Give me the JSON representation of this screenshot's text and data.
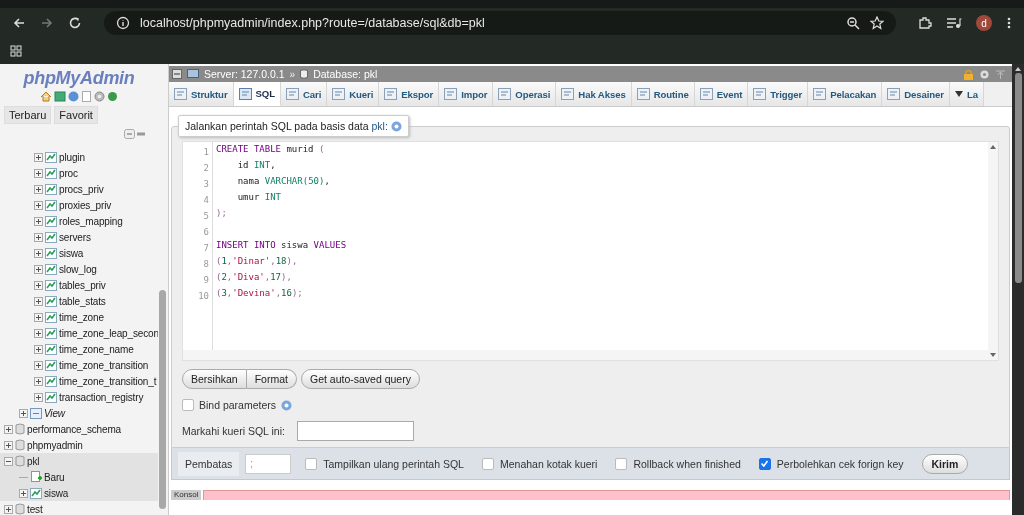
{
  "browser": {
    "url": "localhost/phpmyadmin/index.php?route=/database/sql&db=pkl",
    "profile_initial": "d"
  },
  "sidebar": {
    "logo": "phpMyAdmin",
    "buttons": [
      {
        "label": "Terbaru"
      },
      {
        "label": "Favorit"
      }
    ],
    "tree": [
      {
        "selected": false,
        "children": [
          {
            "children": [
              {
                "label": "plugin",
                "kind": "table",
                "expanded": false
              },
              {
                "label": "proc",
                "kind": "table",
                "expanded": false
              },
              {
                "label": "procs_priv",
                "kind": "table",
                "expanded": false
              },
              {
                "label": "proxies_priv",
                "kind": "table",
                "expanded": false
              },
              {
                "label": "roles_mapping",
                "kind": "table",
                "expanded": false
              },
              {
                "label": "servers",
                "kind": "table",
                "expanded": false
              },
              {
                "label": "siswa",
                "kind": "table",
                "expanded": false
              },
              {
                "label": "slow_log",
                "kind": "table",
                "expanded": false
              },
              {
                "label": "tables_priv",
                "kind": "table",
                "expanded": false
              },
              {
                "label": "table_stats",
                "kind": "table",
                "expanded": false
              },
              {
                "label": "time_zone",
                "kind": "table",
                "expanded": false
              },
              {
                "label": "time_zone_leap_secon",
                "kind": "table",
                "expanded": false
              },
              {
                "label": "time_zone_name",
                "kind": "table",
                "expanded": false
              },
              {
                "label": "time_zone_transition",
                "kind": "table",
                "expanded": false
              },
              {
                "label": "time_zone_transition_t",
                "kind": "table",
                "expanded": false
              },
              {
                "label": "transaction_registry",
                "kind": "table",
                "expanded": false
              }
            ]
          },
          {
            "label": "View",
            "kind": "view",
            "expanded": false
          }
        ]
      },
      {
        "label": "performance_schema",
        "kind": "database",
        "expanded": false,
        "selected": false
      },
      {
        "label": "phpmyadmin",
        "kind": "database",
        "expanded": false,
        "selected": false
      },
      {
        "label": "pkl",
        "kind": "database",
        "expanded": true,
        "selected": true,
        "children": [
          {
            "label": "Baru",
            "kind": "new"
          },
          {
            "label": "siswa",
            "kind": "table",
            "expanded": false
          }
        ]
      },
      {
        "label": "test",
        "kind": "database",
        "expanded": false,
        "selected": false
      }
    ]
  },
  "breadcrumb": {
    "server": "Server: 127.0.0.1",
    "separator": "»",
    "database": "Database: pkl"
  },
  "tabs": [
    {
      "label": "Struktur",
      "selected": false
    },
    {
      "label": "SQL",
      "selected": true
    },
    {
      "label": "Cari",
      "selected": false
    },
    {
      "label": "Kueri",
      "selected": false
    },
    {
      "label": "Ekspor",
      "selected": false
    },
    {
      "label": "Impor",
      "selected": false
    },
    {
      "label": "Operasi",
      "selected": false
    },
    {
      "label": "Hak Akses",
      "selected": false
    },
    {
      "label": "Routine",
      "selected": false
    },
    {
      "label": "Event",
      "selected": false
    },
    {
      "label": "Trigger",
      "selected": false
    },
    {
      "label": "Pelacakan",
      "selected": false
    },
    {
      "label": "Desainer",
      "selected": false
    },
    {
      "label": "La",
      "selected": false,
      "kind": "menu"
    }
  ],
  "query_form": {
    "legend": "Jalankan perintah SQL pada basis data",
    "legend_link": "pkl:",
    "code_lines": [
      {
        "number": "1",
        "tokens": [
          {
            "text": "CREATE TABLE",
            "kind": "keyword"
          },
          {
            "text": " murid ",
            "kind": "plain"
          },
          {
            "text": "(",
            "kind": "punct"
          }
        ]
      },
      {
        "number": "2",
        "tokens": [
          {
            "text": "    id ",
            "kind": "plain"
          },
          {
            "text": "INT",
            "kind": "type"
          },
          {
            "text": ",",
            "kind": "plain"
          }
        ]
      },
      {
        "number": "3",
        "tokens": [
          {
            "text": "    nama ",
            "kind": "plain"
          },
          {
            "text": "VARCHAR(50)",
            "kind": "type"
          },
          {
            "text": ",",
            "kind": "plain"
          }
        ]
      },
      {
        "number": "4",
        "tokens": [
          {
            "text": "    umur ",
            "kind": "plain"
          },
          {
            "text": "INT",
            "kind": "type"
          }
        ]
      },
      {
        "number": "5",
        "tokens": [
          {
            "text": ");",
            "kind": "punct"
          }
        ]
      },
      {
        "number": "6"
      },
      {
        "number": "7",
        "tokens": [
          {
            "text": "INSERT INTO",
            "kind": "keyword"
          },
          {
            "text": " siswa ",
            "kind": "plain"
          },
          {
            "text": "VALUES",
            "kind": "keyword"
          }
        ]
      },
      {
        "number": "8",
        "tokens": [
          {
            "text": "(",
            "kind": "punct"
          },
          {
            "text": "1",
            "kind": "number"
          },
          {
            "text": ",",
            "kind": "punct"
          },
          {
            "text": "'Dinar'",
            "kind": "string"
          },
          {
            "text": ",",
            "kind": "punct"
          },
          {
            "text": "18",
            "kind": "number"
          },
          {
            "text": "),",
            "kind": "punct"
          }
        ]
      },
      {
        "number": "9",
        "tokens": [
          {
            "text": "(",
            "kind": "punct"
          },
          {
            "text": "2",
            "kind": "number"
          },
          {
            "text": ",",
            "kind": "punct"
          },
          {
            "text": "'Diva'",
            "kind": "string"
          },
          {
            "text": ",",
            "kind": "punct"
          },
          {
            "text": "17",
            "kind": "number"
          },
          {
            "text": "),",
            "kind": "punct"
          }
        ]
      },
      {
        "number": "10",
        "tokens": [
          {
            "text": "(",
            "kind": "punct"
          },
          {
            "text": "3",
            "kind": "number"
          },
          {
            "text": ",",
            "kind": "punct"
          },
          {
            "text": "'Devina'",
            "kind": "string"
          },
          {
            "text": ",",
            "kind": "punct"
          },
          {
            "text": "16",
            "kind": "number"
          },
          {
            "text": ");",
            "kind": "punct"
          }
        ]
      }
    ],
    "buttons": [
      "Bersihkan",
      "Format"
    ],
    "autosave_button": "Get auto-saved query",
    "bind_parameters": {
      "label": "Bind parameters",
      "checked": false
    },
    "bookmark_label": "Markahi kueri SQL ini:"
  },
  "options": {
    "delimiter_label": "Pembatas",
    "delimiter": ";",
    "checkboxes": [
      {
        "label": "Tampilkan ulang perintah SQL",
        "checked": false
      },
      {
        "label": "Menahan kotak kueri",
        "checked": false
      },
      {
        "label": "Rollback when finished",
        "checked": false
      },
      {
        "label": "Perbolehkan cek forign key",
        "checked": true
      }
    ],
    "submit": "Kirim"
  },
  "console": {
    "label": "Konsol"
  }
}
